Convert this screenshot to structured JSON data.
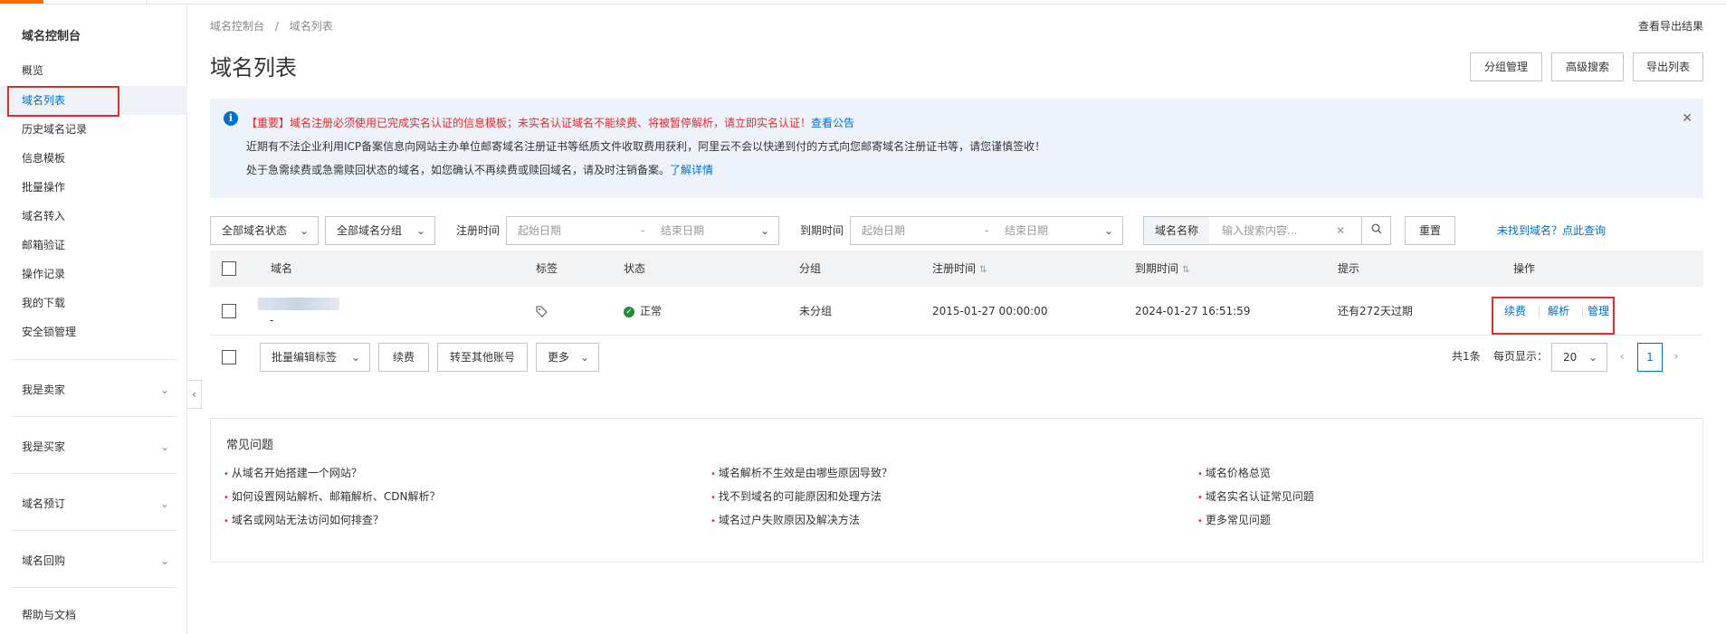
{
  "colors": {
    "accent": "#0070cc",
    "brand": "#ff6a00",
    "highlight_red": "#e8292f",
    "status_ok": "#1e8e3e"
  },
  "sidebar": {
    "title": "域名控制台",
    "items": [
      {
        "label": "概览"
      },
      {
        "label": "域名列表",
        "active": true
      },
      {
        "label": "历史域名记录"
      },
      {
        "label": "信息模板"
      },
      {
        "label": "批量操作"
      },
      {
        "label": "域名转入"
      },
      {
        "label": "邮箱验证"
      },
      {
        "label": "操作记录"
      },
      {
        "label": "我的下载"
      },
      {
        "label": "安全锁管理"
      }
    ],
    "groups": [
      {
        "label": "我是卖家"
      },
      {
        "label": "我是买家"
      },
      {
        "label": "域名预订"
      },
      {
        "label": "域名回购"
      }
    ],
    "help": "帮助与文档"
  },
  "header": {
    "breadcrumb": [
      "域名控制台",
      "/",
      "域名列表"
    ],
    "export_result": "查看导出结果",
    "title": "域名列表",
    "buttons": {
      "group_manage": "分组管理",
      "advanced_search": "高级搜索",
      "export_list": "导出列表"
    }
  },
  "notice": {
    "line1_red": "【重要】域名注册必须使用已完成实名认证的信息模板；未实名认证域名不能续费、将被暂停解析，请立即实名认证！",
    "line1_link": "查看公告",
    "line2": "近期有不法企业利用ICP备案信息向网站主办单位邮寄域名注册证书等纸质文件收取费用获利，阿里云不会以快递到付的方式向您邮寄域名注册证书等，请您谨慎签收！",
    "line3": "处于急需续费或急需赎回状态的域名，如您确认不再续费或赎回域名，请及时注销备案。",
    "line3_link": "了解详情"
  },
  "filters": {
    "status": "全部域名状态",
    "group": "全部域名分组",
    "reg_label": "注册时间",
    "reg_start": "起始日期",
    "reg_end": "结束日期",
    "exp_label": "到期时间",
    "exp_start": "起始日期",
    "exp_end": "结束日期",
    "search_type": "域名名称",
    "search_placeholder": "输入搜索内容...",
    "reset": "重置",
    "not_found": "未找到域名？点此查询",
    "dash": "-"
  },
  "table": {
    "columns": [
      "域名",
      "标签",
      "状态",
      "分组",
      "注册时间",
      "到期时间",
      "提示",
      "操作"
    ],
    "rows": [
      {
        "domain_suffix": "-",
        "status": "正常",
        "group": "未分组",
        "reg_time": "2015-01-27 00:00:00",
        "exp_time": "2024-01-27 16:51:59",
        "tip": "还有272天过期",
        "actions": [
          "续费",
          "解析",
          "管理"
        ]
      }
    ]
  },
  "bulk": {
    "edit_tags": "批量编辑标签",
    "renew": "续费",
    "transfer": "转至其他账号",
    "more": "更多"
  },
  "pagination": {
    "total": "共1条",
    "per_page_label": "每页显示：",
    "per_page": "20",
    "current": "1"
  },
  "faq": {
    "title": "常见问题",
    "col1": [
      "从域名开始搭建一个网站？",
      "如何设置网站解析、邮箱解析、CDN解析？",
      "域名或网站无法访问如何排查？"
    ],
    "col2": [
      "域名解析不生效是由哪些原因导致？",
      "找不到域名的可能原因和处理方法",
      "域名过户失败原因及解决方法"
    ],
    "col3": [
      "域名价格总览",
      "域名实名认证常见问题",
      "更多常见问题"
    ]
  }
}
